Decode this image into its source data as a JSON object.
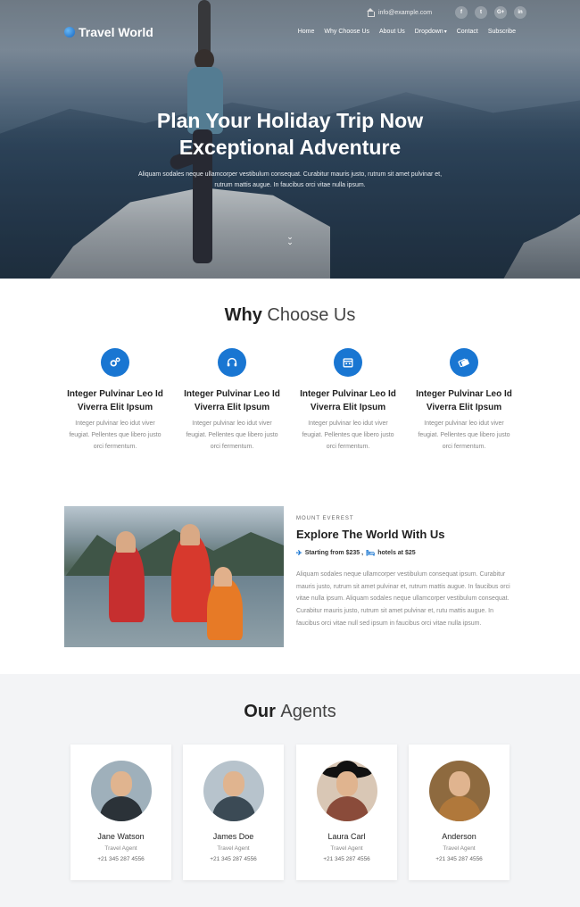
{
  "brand": {
    "name": "Travel World"
  },
  "topbar": {
    "email": "info@example.com",
    "social": [
      "f",
      "t",
      "G+",
      "in"
    ]
  },
  "nav": {
    "items": [
      "Home",
      "Why Choose Us",
      "About Us",
      "Dropdown",
      "Contact",
      "Subscribe"
    ]
  },
  "hero": {
    "title_line1": "Plan Your Holiday Trip Now",
    "title_line2": "Exceptional Adventure",
    "text": "Aliquam sodales neque ullamcorper vestibulum consequat. Curabitur mauris justo, rutrum sit amet pulvinar et, rutrum mattis augue. In faucibus orci vitae nulla ipsum."
  },
  "why": {
    "title_bold": "Why",
    "title_light": "Choose Us",
    "features": [
      {
        "icon": "cogs-icon",
        "title": "Integer Pulvinar Leo Id Viverra Elit Ipsum",
        "text": "Integer pulvinar leo idut viver feugiat. Pellentes que libero justo orci fermentum."
      },
      {
        "icon": "headphones-icon",
        "title": "Integer Pulvinar Leo Id Viverra Elit Ipsum",
        "text": "Integer pulvinar leo idut viver feugiat. Pellentes que libero justo orci fermentum."
      },
      {
        "icon": "calendar-icon",
        "title": "Integer Pulvinar Leo Id Viverra Elit Ipsum",
        "text": "Integer pulvinar leo idut viver feugiat. Pellentes que libero justo orci fermentum."
      },
      {
        "icon": "tickets-icon",
        "title": "Integer Pulvinar Leo Id Viverra Elit Ipsum",
        "text": "Integer pulvinar leo idut viver feugiat. Pellentes que libero justo orci fermentum."
      }
    ]
  },
  "explore": {
    "subtitle": "MOUNT EVEREST",
    "title": "Explore The World With Us",
    "price_flight": "Starting from $235 ,",
    "price_hotel": "hotels at $25",
    "text": "Aliquam sodales neque ullamcorper vestibulum consequat ipsum. Curabitur mauris justo, rutrum sit amet pulvinar et, rutrum mattis augue. In faucibus orci vitae nulla ipsum. Aliquam sodales neque ullamcorper vestibulum consequat. Curabitur mauris justo, rutrum sit amet pulvinar et, rutu mattis augue. In faucibus orci vitae null sed ipsum in faucibus orci vitae nulla ipsum."
  },
  "agents": {
    "title_bold": "Our",
    "title_light": "Agents",
    "list": [
      {
        "name": "Jane Watson",
        "role": "Travel Agent",
        "phone": "+21 345 287 4556"
      },
      {
        "name": "James Doe",
        "role": "Travel Agent",
        "phone": "+21 345 287 4556"
      },
      {
        "name": "Laura Carl",
        "role": "Travel Agent",
        "phone": "+21 345 287 4556"
      },
      {
        "name": "Anderson",
        "role": "Travel Agent",
        "phone": "+21 345 287 4556"
      }
    ]
  },
  "colors": {
    "accent": "#1976d2",
    "section_gray": "#f3f4f6"
  }
}
